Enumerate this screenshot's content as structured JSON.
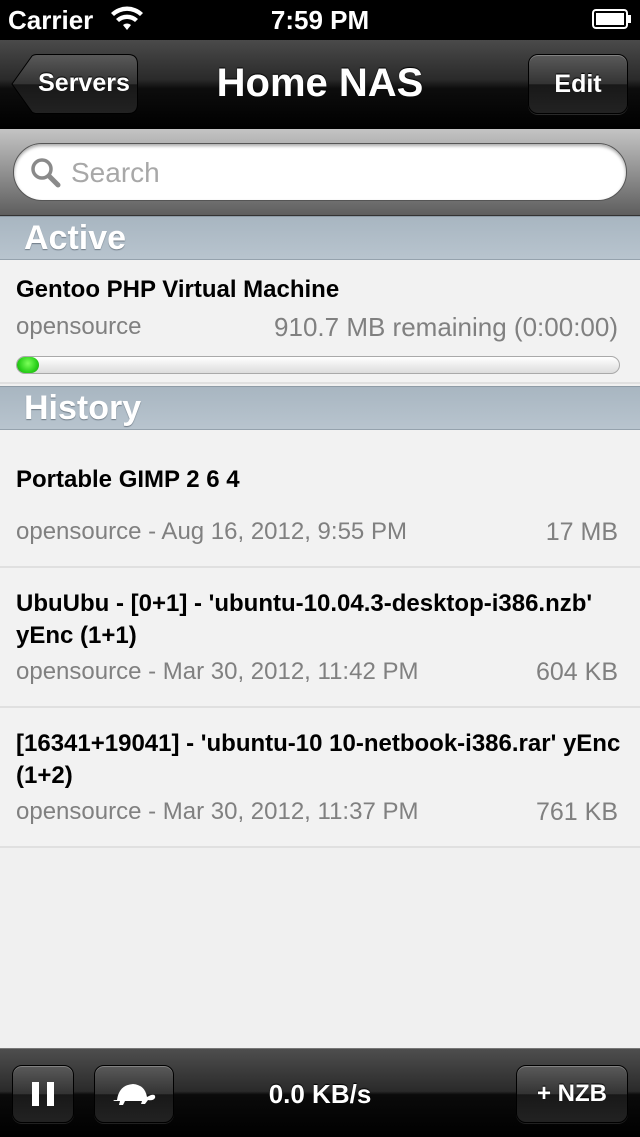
{
  "status_bar": {
    "carrier": "Carrier",
    "time": "7:59 PM"
  },
  "nav": {
    "back_label": "Servers",
    "title": "Home NAS",
    "edit_label": "Edit"
  },
  "search": {
    "placeholder": "Search"
  },
  "sections": {
    "active": "Active",
    "history": "History"
  },
  "active_items": [
    {
      "title": "Gentoo PHP Virtual Machine",
      "category": "opensource",
      "remaining": "910.7 MB remaining (0:00:00)",
      "progress_fraction": 0.03
    }
  ],
  "history_items": [
    {
      "title": "Portable GIMP 2 6 4",
      "subtitle": "opensource - Aug 16, 2012, 9:55 PM",
      "size": "17 MB"
    },
    {
      "title": "UbuUbu - [0+1] - 'ubuntu-10.04.3-desktop-i386.nzb' yEnc (1+1)",
      "subtitle": "opensource - Mar 30, 2012, 11:42 PM",
      "size": "604 KB"
    },
    {
      "title": "[16341+19041] - 'ubuntu-10 10-netbook-i386.rar' yEnc (1+2)",
      "subtitle": "opensource - Mar 30, 2012, 11:37 PM",
      "size": "761 KB"
    }
  ],
  "toolbar": {
    "speed": "0.0 KB/s",
    "add_nzb_label": "+ NZB",
    "icons": [
      "pause-icon",
      "turtle-icon"
    ]
  },
  "colors": {
    "progress_green": "#2bd11b",
    "section_header": "#b0bdc8"
  }
}
